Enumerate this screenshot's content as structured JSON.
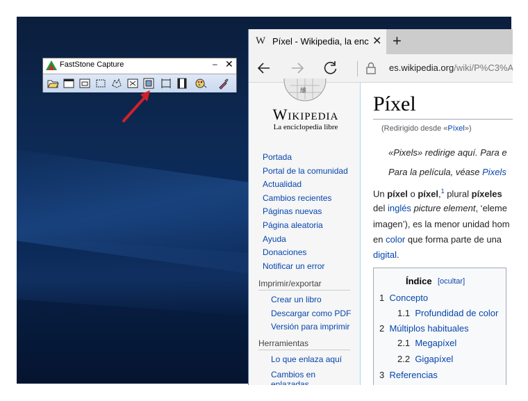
{
  "faststone": {
    "title": "FastStone Capture",
    "minimize": "–",
    "close": "✕",
    "tools": [
      "open-icon",
      "capture-window-icon",
      "capture-object-icon",
      "capture-rectangle-icon",
      "capture-freehand-icon",
      "capture-fullscreen-icon",
      "capture-scrolling-icon",
      "capture-fixed-region-icon",
      "capture-video-icon",
      "color-output-icon",
      "settings-icon"
    ]
  },
  "browser": {
    "tab": {
      "favicon": "W",
      "title": "Píxel - Wikipedia, la enc",
      "close": "✕"
    },
    "new_tab": "+",
    "url_host": "es.wikipedia.org",
    "url_path": "/wiki/P%C3%A"
  },
  "wiki": {
    "wordmark": "Wikipedia",
    "tagline": "La enciclopedia libre",
    "nav": [
      "Portada",
      "Portal de la comunidad",
      "Actualidad",
      "Cambios recientes",
      "Páginas nuevas",
      "Página aleatoria",
      "Ayuda",
      "Donaciones",
      "Notificar un error"
    ],
    "print_export": {
      "heading": "Imprimir/exportar",
      "items": [
        "Crear un libro",
        "Descargar como PDF",
        "Versión para imprimir"
      ]
    },
    "tools": {
      "heading": "Herramientas",
      "items": [
        "Lo que enlaza aquí",
        "Cambios en",
        "enlazadas"
      ]
    },
    "article": {
      "title": "Píxel",
      "redirect_prefix": "(Redirigido desde «",
      "redirect_link": "Píxel",
      "redirect_suffix": "»)",
      "hatnote1": "«Pixels» redirige aquí. Para e",
      "hatnote2_prefix": "Para la película, véase ",
      "hatnote2_link": "Pixels",
      "p1_a": "Un ",
      "p1_b": "píxel",
      "p1_c": " o ",
      "p1_d": "píxel",
      "p1_e": ",",
      "p1_sup": "1",
      "p1_f": " plural ",
      "p1_g": "píxeles",
      "p2_a": "del ",
      "p2_link": "inglés",
      "p2_b": " ",
      "p2_i": "picture element",
      "p2_c": ", ‘eleme",
      "p3": "imagen’), es la menor unidad hom",
      "p4_a": "en ",
      "p4_link": "color",
      "p4_b": " que forma parte de una",
      "p5_link": "digital",
      "p5_b": "."
    },
    "toc": {
      "title": "Índice",
      "hide": "[ocultar]",
      "items": [
        {
          "num": "1",
          "label": "Concepto"
        },
        {
          "num": "1.1",
          "label": "Profundidad de color"
        },
        {
          "num": "2",
          "label": "Múltiplos habituales"
        },
        {
          "num": "2.1",
          "label": "Megapíxel"
        },
        {
          "num": "2.2",
          "label": "Gigapíxel"
        },
        {
          "num": "3",
          "label": "Referencias"
        }
      ]
    }
  },
  "colors": {
    "link": "#0645ad",
    "arrow": "#d0202a",
    "toolbar_accent": "#c8d8ee"
  }
}
